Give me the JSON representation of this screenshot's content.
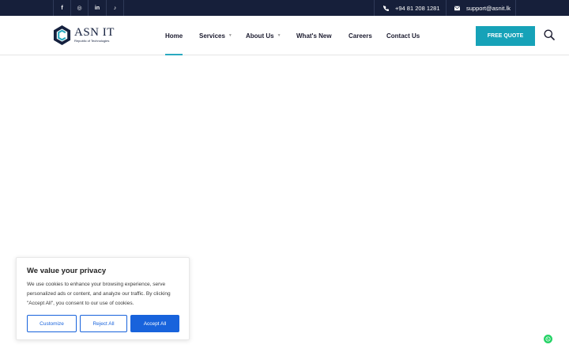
{
  "topbar": {
    "social": [
      {
        "icon": "facebook-icon",
        "glyph": "f"
      },
      {
        "icon": "instagram-icon",
        "glyph": "◎"
      },
      {
        "icon": "linkedin-icon",
        "glyph": "in"
      },
      {
        "icon": "tiktok-icon",
        "glyph": "♪"
      }
    ],
    "phone": "+94 81 208 1281",
    "email": "support@asnit.lk"
  },
  "header": {
    "logo": {
      "name": "ASN IT",
      "tagline": "Republic of Technologies"
    },
    "nav": {
      "home": "Home",
      "services": "Services",
      "about": "About Us",
      "news": "What's New",
      "careers": "Careers",
      "contact": "Contact Us"
    },
    "quote_button": "FREE QUOTE",
    "accent_color": "#16a2b8"
  },
  "cookie": {
    "title": "We value your privacy",
    "text": "We use cookies to enhance your browsing experience, serve personalized ads or content, and analyze our traffic. By clicking \"Accept All\", you consent to our use of cookies.",
    "customize": "Customize",
    "reject": "Reject All",
    "accept": "Accept All",
    "button_color": "#1863dc"
  },
  "colors": {
    "topbar_bg": "#161f3a",
    "whatsapp": "#25d366"
  }
}
